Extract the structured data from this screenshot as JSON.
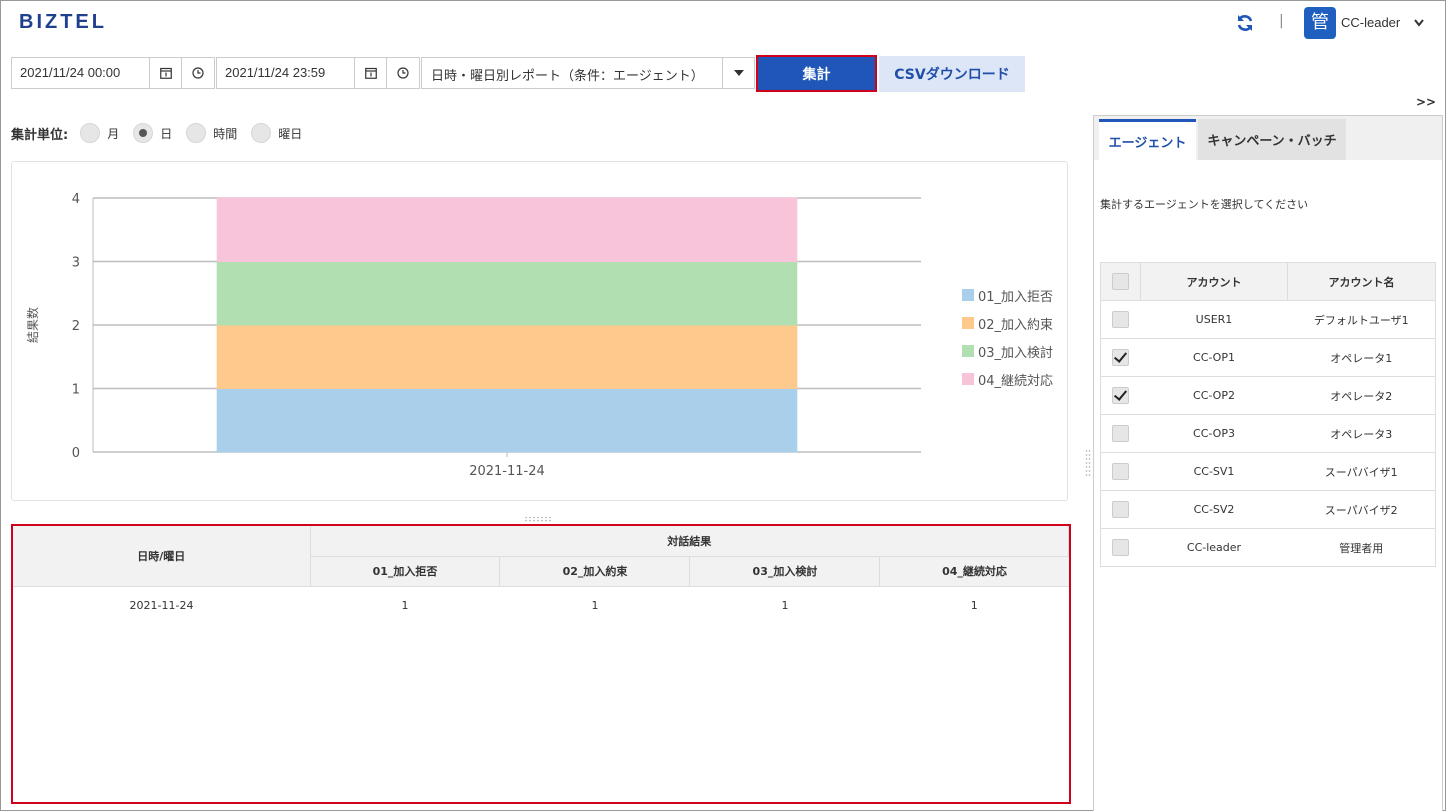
{
  "header": {
    "logo": "BIZTEL",
    "separator": "|",
    "avatar_char": "管",
    "user_name": "CC-leader"
  },
  "toolbar": {
    "start_datetime": "2021/11/24 00:00",
    "end_datetime": "2021/11/24 23:59",
    "report_type": "日時・曜日別レポート（条件：エージェント）",
    "aggregate_label": "集計",
    "csv_label": "CSVダウンロード",
    "expand_label": ">>"
  },
  "unit": {
    "label": "集計単位:",
    "options": [
      {
        "label": "月",
        "selected": false
      },
      {
        "label": "日",
        "selected": true
      },
      {
        "label": "時間",
        "selected": false
      },
      {
        "label": "曜日",
        "selected": false
      }
    ]
  },
  "chart_data": {
    "type": "bar",
    "stacked": true,
    "categories": [
      "2021-11-24"
    ],
    "series": [
      {
        "name": "01_加入拒否",
        "values": [
          1
        ],
        "color": "#a9cfeb"
      },
      {
        "name": "02_加入約束",
        "values": [
          1
        ],
        "color": "#fdc98c"
      },
      {
        "name": "03_加入検討",
        "values": [
          1
        ],
        "color": "#b1dfb2"
      },
      {
        "name": "04_継続対応",
        "values": [
          1
        ],
        "color": "#f8c4da"
      }
    ],
    "ylabel": "結果数",
    "ylim": [
      0,
      4
    ],
    "yticks": [
      "0",
      "1",
      "2",
      "3",
      "4"
    ],
    "grid": true,
    "legend": "right"
  },
  "table": {
    "col_datetime": "日時/曜日",
    "group_header": "対話結果",
    "columns": [
      "01_加入拒否",
      "02_加入約束",
      "03_加入検討",
      "04_継続対応"
    ],
    "rows": [
      {
        "date": "2021-11-24",
        "values": [
          "1",
          "1",
          "1",
          "1"
        ]
      }
    ]
  },
  "side": {
    "tabs": [
      "エージェント",
      "キャンペーン・バッチ"
    ],
    "instruction": "集計するエージェントを選択してください",
    "col_account": "アカウント",
    "col_account_name": "アカウント名",
    "agents": [
      {
        "account": "USER1",
        "name": "デフォルトユーザ1",
        "checked": false
      },
      {
        "account": "CC-OP1",
        "name": "オペレータ1",
        "checked": true
      },
      {
        "account": "CC-OP2",
        "name": "オペレータ2",
        "checked": true
      },
      {
        "account": "CC-OP3",
        "name": "オペレータ3",
        "checked": false
      },
      {
        "account": "CC-SV1",
        "name": "スーパバイザ1",
        "checked": false
      },
      {
        "account": "CC-SV2",
        "name": "スーパバイザ2",
        "checked": false
      },
      {
        "account": "CC-leader",
        "name": "管理者用",
        "checked": false
      }
    ]
  }
}
